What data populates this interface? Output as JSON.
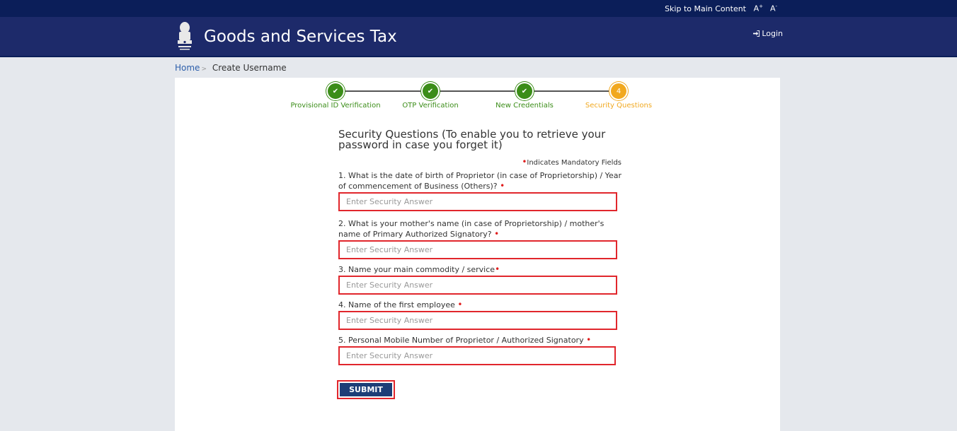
{
  "topbar": {
    "skip_link": "Skip to Main Content",
    "font_increase": "A",
    "font_increase_sup": "+",
    "font_decrease": "A",
    "font_decrease_sup": "-"
  },
  "header": {
    "brand": "Goods and Services Tax",
    "login": "Login",
    "emblem_icon": "national-emblem-icon",
    "login_icon": "sign-in-icon"
  },
  "breadcrumb": {
    "home": "Home",
    "current": "Create Username"
  },
  "stepper": {
    "steps": [
      {
        "label": "Provisional ID Verification",
        "state": "done",
        "marker": "✔"
      },
      {
        "label": "OTP Verification",
        "state": "done",
        "marker": "✔"
      },
      {
        "label": "New Credentials",
        "state": "done",
        "marker": "✔"
      },
      {
        "label": "Security Questions",
        "state": "active",
        "marker": "4"
      }
    ]
  },
  "form": {
    "title": "Security Questions (To enable you to retrieve your password in case you forget it)",
    "mandatory_note": "Indicates Mandatory Fields",
    "placeholder": "Enter Security Answer",
    "questions": [
      {
        "label": "1. What is the date of birth of Proprietor (in case of Proprietorship) / Year of commencement of Business (Others)?"
      },
      {
        "label": "2. What is your mother's name (in case of Proprietorship) / mother's name of Primary Authorized Signatory?"
      },
      {
        "label": "3. Name your main commodity / service"
      },
      {
        "label": "4. Name of the first employee"
      },
      {
        "label": "5. Personal Mobile Number of Proprietor / Authorized Signatory"
      }
    ],
    "submit": "SUBMIT"
  },
  "colors": {
    "header_bg": "#1d2a6a",
    "topbar_bg": "#0b1e59",
    "step_done": "#3b8d18",
    "step_active": "#f1a81f",
    "highlight_border": "#e1262c",
    "submit_bg": "#1d3e77"
  }
}
